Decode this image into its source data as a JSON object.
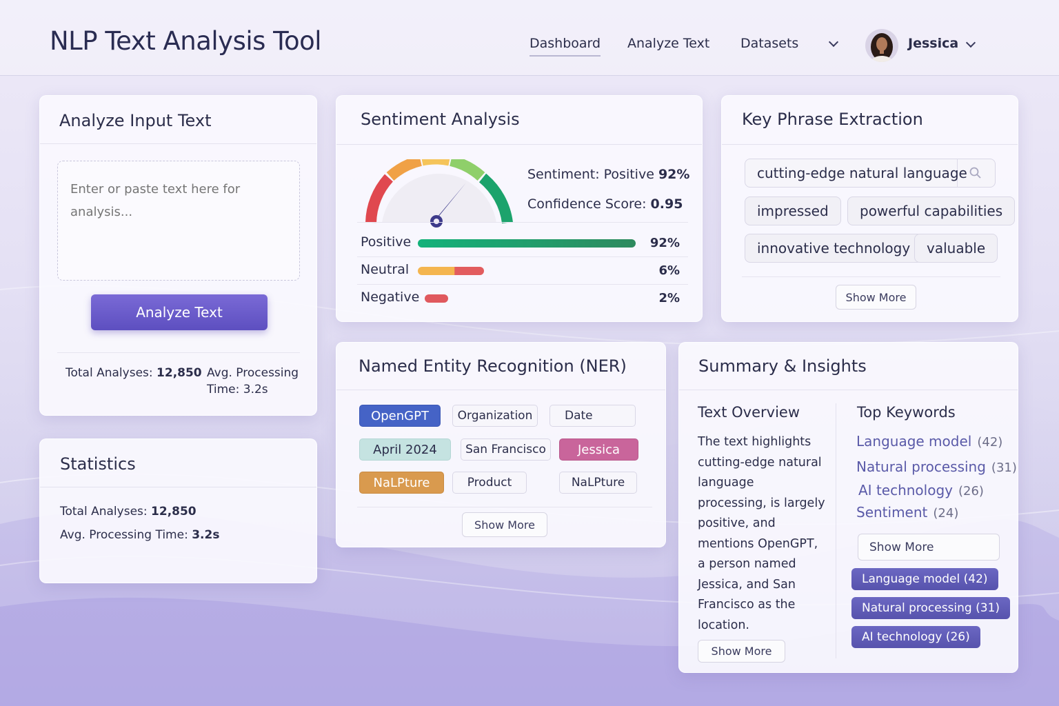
{
  "header": {
    "app_title": "NLP Text Analysis Tool",
    "nav": [
      "Dashboard",
      "Analyze Text",
      "Datasets"
    ],
    "user_name": "Jessica"
  },
  "analyze_input": {
    "title": "Analyze Input Text",
    "placeholder": "Enter or paste text here for analysis...",
    "button_label": "Analyze Text",
    "total_label": "Total Analyses:",
    "total_value": "12,850",
    "avg_label": "Avg. Processing Time:",
    "avg_value": "3.2s"
  },
  "statistics": {
    "title": "Statistics",
    "total_label": "Total Analyses:",
    "total_value": "12,850",
    "avg_label": "Avg. Processing Time:",
    "avg_value": "3.2s"
  },
  "sentiment": {
    "title": "Sentiment Analysis",
    "sentiment_label": "Sentiment: Positive",
    "sentiment_value": "92%",
    "confidence_label": "Confidence Score:",
    "confidence_value": "0.95",
    "rows": [
      {
        "label": "Positive",
        "pct": "92%",
        "fraction": 0.92
      },
      {
        "label": "Neutral",
        "pct": "6%",
        "fraction": 0.06
      },
      {
        "label": "Negative",
        "pct": "2%",
        "fraction": 0.02
      }
    ]
  },
  "key_phrases": {
    "title": "Key Phrase Extraction",
    "search_value": "cutting-edge natural language",
    "phrases": [
      "impressed",
      "powerful capabilities",
      "innovative technology",
      "valuable"
    ],
    "show_more": "Show More"
  },
  "ner": {
    "title": "Named Entity Recognition (NER)",
    "tags": [
      "OpenGPT",
      "Organization",
      "Date",
      "April 2024",
      "San Francisco",
      "Jessica",
      "NaLPture",
      "Product",
      "NaLPture"
    ],
    "show_more": "Show More"
  },
  "summary": {
    "title": "Summary & Insights",
    "overview_title": "Text Overview",
    "overview_text": "The text highlights cutting-edge natural language processing, is largely positive, and mentions OpenGPT, a person named Jessica, and San Francisco as the location.",
    "overview_show_more": "Show More",
    "keywords_title": "Top Keywords",
    "keywords": [
      {
        "name": "Language model",
        "count": "(42)"
      },
      {
        "name": "Natural processing",
        "count": "(31)"
      },
      {
        "name": "AI technology",
        "count": "(26)"
      },
      {
        "name": "Sentiment",
        "count": "(24)"
      }
    ],
    "keywords_show_more": "Show More",
    "pills": [
      "Language model (42)",
      "Natural processing (31)",
      "AI technology (26)"
    ]
  },
  "colors": {
    "primary_button": "#5d4fc0",
    "positive": "#19a874",
    "neutral": "#f2b04d",
    "negative": "#e0595e",
    "ner_org": "#4563c6",
    "ner_date": "#bfe0df",
    "ner_person": "#c9659b",
    "ner_product": "#d99a4e",
    "keyword_pill": "#5e5ab6"
  }
}
